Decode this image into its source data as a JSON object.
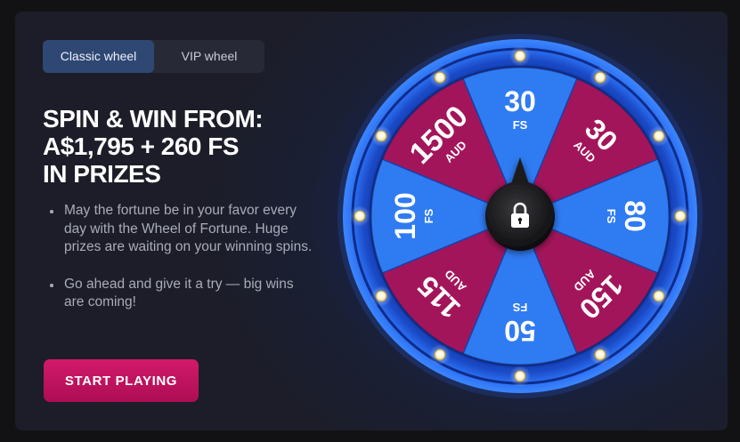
{
  "tabs": [
    {
      "label": "Classic wheel",
      "active": true
    },
    {
      "label": "VIP wheel",
      "active": false
    }
  ],
  "headline": [
    "SPIN & WIN FROM:",
    "A$1,795 + 260 FS",
    "IN PRIZES"
  ],
  "bullets": [
    "May the fortune be in your favor every day with the Wheel of Fortune. Huge prizes are waiting on your winning spins.",
    "Go ahead and give it a try — big wins are coming!"
  ],
  "cta_label": "START PLAYING",
  "wheel": {
    "segments": [
      {
        "amount": "30",
        "unit": "FS",
        "color": "#2f7bf2"
      },
      {
        "amount": "30",
        "unit": "AUD",
        "color": "#a3155a"
      },
      {
        "amount": "80",
        "unit": "FS",
        "color": "#2f7bf2"
      },
      {
        "amount": "150",
        "unit": "AUD",
        "color": "#a3155a"
      },
      {
        "amount": "50",
        "unit": "FS",
        "color": "#2f7bf2"
      },
      {
        "amount": "115",
        "unit": "AUD",
        "color": "#a3155a"
      },
      {
        "amount": "100",
        "unit": "FS",
        "color": "#2f7bf2"
      },
      {
        "amount": "1500",
        "unit": "AUD",
        "color": "#a3155a"
      }
    ],
    "center_icon": "lock-icon",
    "rim_color": "#1d56d8"
  }
}
